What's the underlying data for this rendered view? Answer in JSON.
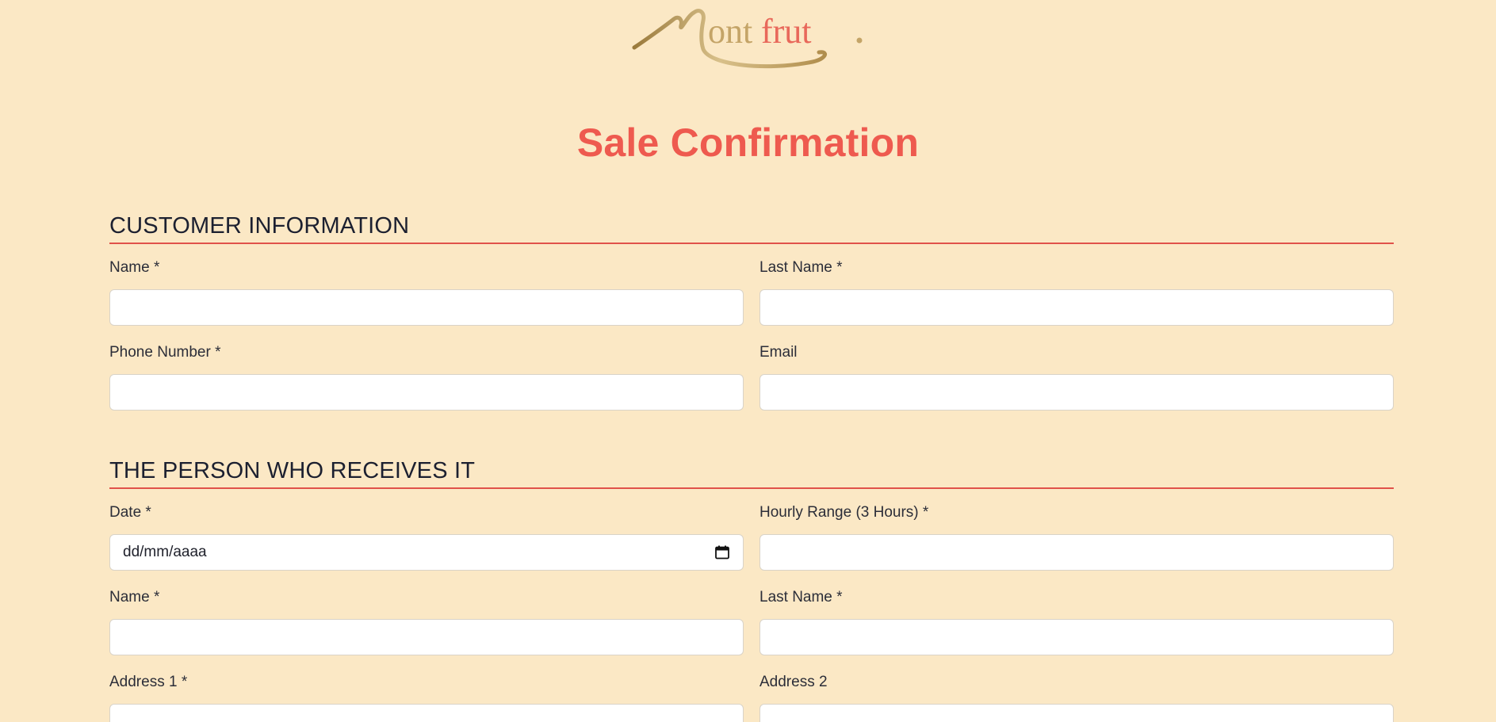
{
  "brand": {
    "logo_text": "Montfrut",
    "colors": {
      "gold": "#b8965a",
      "coral": "#e8685a",
      "background": "#fbe8c5",
      "accent": "#ee5a4f",
      "divider": "#e0524a"
    }
  },
  "page": {
    "title": "Sale Confirmation"
  },
  "customer_section": {
    "heading": "CUSTOMER INFORMATION",
    "fields": [
      {
        "label": "Name *",
        "value": ""
      },
      {
        "label": "Last Name *",
        "value": ""
      },
      {
        "label": "Phone Number *",
        "value": ""
      },
      {
        "label": "Email",
        "value": ""
      }
    ]
  },
  "receiver_section": {
    "heading": "THE PERSON WHO RECEIVES IT",
    "fields": [
      {
        "label": "Date *",
        "value": "",
        "placeholder": "dd/mm/aaaa",
        "icon": "calendar-icon"
      },
      {
        "label": "Hourly Range (3 Hours) *",
        "value": ""
      },
      {
        "label": "Name *",
        "value": ""
      },
      {
        "label": "Last Name *",
        "value": ""
      },
      {
        "label": "Address 1 *",
        "value": ""
      },
      {
        "label": "Address 2",
        "value": ""
      }
    ]
  }
}
